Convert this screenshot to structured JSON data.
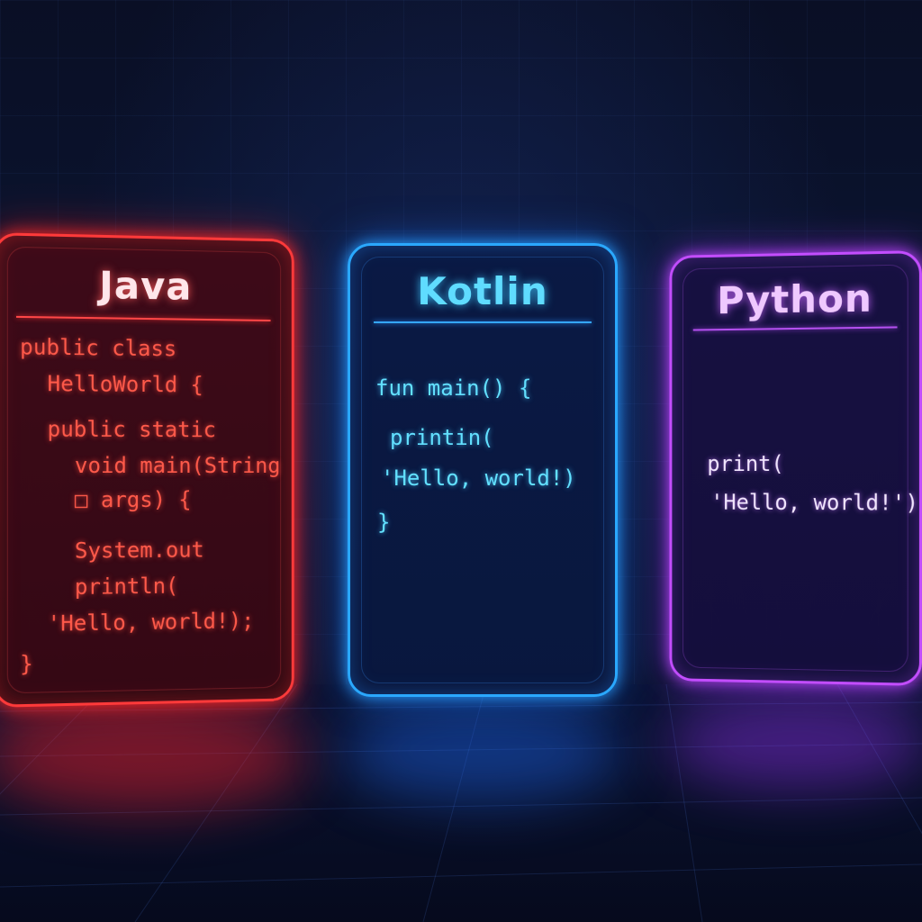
{
  "cards": [
    {
      "title": "Java",
      "color": "#ff3a3a",
      "lines": [
        "public class",
        "HelloWorld {",
        "public static",
        "void main(String",
        "□ args) {",
        "System.out",
        "println(",
        "'Hello, world!);",
        "}"
      ]
    },
    {
      "title": "Kotlin",
      "color": "#2aa8ff",
      "lines": [
        "fun main() {",
        "printin(",
        "'Hello, world!)",
        "}"
      ]
    },
    {
      "title": "Python",
      "color": "#c34dff",
      "lines": [
        "print(",
        "'Hello, world!')"
      ]
    }
  ]
}
